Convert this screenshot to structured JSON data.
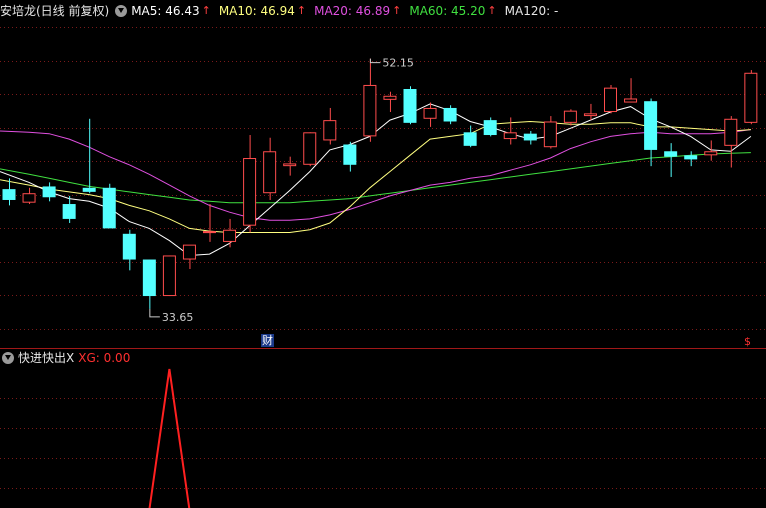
{
  "header": {
    "stock_title": "安培龙(日线 前复权)",
    "ma5_label": "MA5: 46.43",
    "ma10_label": "MA10: 46.94",
    "ma20_label": "MA20: 46.89",
    "ma60_label": "MA60: 45.20",
    "ma120_label": "MA120: -",
    "up_arrow": "↑"
  },
  "indicator_header": {
    "title": "快进快出X",
    "xg_label": "XG: 0.00"
  },
  "badges": {
    "finance": "财",
    "extra": "$"
  },
  "colors": {
    "up": "#ff4d4d",
    "down": "#54ffff",
    "ma5": "#ffffff",
    "ma10": "#ffff80",
    "ma20": "#e050e0",
    "ma60": "#40e040",
    "grid": "#7a1a1a",
    "divider": "#a01818",
    "indicator": "#ff2020"
  },
  "chart_data": {
    "type": "candlestick",
    "price_range": [
      31.5,
      55.0
    ],
    "annotations": {
      "high_label": "52.15",
      "low_label": "33.65"
    },
    "candles": [
      {
        "o": 42.5,
        "h": 43.3,
        "l": 41.3,
        "c": 41.7
      },
      {
        "o": 41.5,
        "h": 42.6,
        "l": 41.4,
        "c": 42.2
      },
      {
        "o": 42.7,
        "h": 43.0,
        "l": 41.6,
        "c": 41.9
      },
      {
        "o": 41.4,
        "h": 42.0,
        "l": 40.0,
        "c": 40.3
      },
      {
        "o": 42.6,
        "h": 47.7,
        "l": 42.2,
        "c": 42.3
      },
      {
        "o": 42.6,
        "h": 42.9,
        "l": 40.2,
        "c": 39.6
      },
      {
        "o": 39.2,
        "h": 39.5,
        "l": 36.5,
        "c": 37.3
      },
      {
        "o": 37.3,
        "h": 37.3,
        "l": 33.65,
        "c": 34.6
      },
      {
        "o": 34.6,
        "h": 37.6,
        "l": 34.6,
        "c": 37.6
      },
      {
        "o": 37.3,
        "h": 38.2,
        "l": 36.6,
        "c": 38.4
      },
      {
        "o": 39.4,
        "h": 41.4,
        "l": 38.6,
        "c": 39.4
      },
      {
        "o": 38.6,
        "h": 40.3,
        "l": 38.2,
        "c": 39.5
      },
      {
        "o": 39.8,
        "h": 46.5,
        "l": 39.3,
        "c": 44.8
      },
      {
        "o": 42.2,
        "h": 46.3,
        "l": 41.7,
        "c": 45.3
      },
      {
        "o": 44.2,
        "h": 44.9,
        "l": 43.5,
        "c": 44.4
      },
      {
        "o": 44.3,
        "h": 46.7,
        "l": 44.2,
        "c": 46.7
      },
      {
        "o": 46.1,
        "h": 48.5,
        "l": 45.8,
        "c": 47.6
      },
      {
        "o": 45.8,
        "h": 46.0,
        "l": 43.8,
        "c": 44.3
      },
      {
        "o": 46.4,
        "h": 52.15,
        "l": 46.0,
        "c": 50.2
      },
      {
        "o": 49.1,
        "h": 49.7,
        "l": 48.2,
        "c": 49.4
      },
      {
        "o": 49.9,
        "h": 50.1,
        "l": 47.3,
        "c": 47.4
      },
      {
        "o": 47.7,
        "h": 48.9,
        "l": 47.1,
        "c": 48.5
      },
      {
        "o": 48.5,
        "h": 48.7,
        "l": 47.3,
        "c": 47.5
      },
      {
        "o": 46.7,
        "h": 47.2,
        "l": 45.6,
        "c": 45.7
      },
      {
        "o": 47.6,
        "h": 47.8,
        "l": 46.4,
        "c": 46.5
      },
      {
        "o": 46.2,
        "h": 47.8,
        "l": 45.8,
        "c": 46.7
      },
      {
        "o": 46.6,
        "h": 46.8,
        "l": 45.8,
        "c": 46.1
      },
      {
        "o": 45.6,
        "h": 47.9,
        "l": 45.5,
        "c": 47.5
      },
      {
        "o": 47.4,
        "h": 48.4,
        "l": 47.2,
        "c": 48.3
      },
      {
        "o": 47.9,
        "h": 48.8,
        "l": 47.6,
        "c": 48.1
      },
      {
        "o": 48.2,
        "h": 50.2,
        "l": 48.1,
        "c": 50.0
      },
      {
        "o": 48.9,
        "h": 50.7,
        "l": 48.9,
        "c": 49.2
      },
      {
        "o": 49.0,
        "h": 49.2,
        "l": 44.2,
        "c": 45.4
      },
      {
        "o": 45.3,
        "h": 45.9,
        "l": 43.4,
        "c": 44.9
      },
      {
        "o": 45.0,
        "h": 45.3,
        "l": 44.2,
        "c": 44.7
      },
      {
        "o": 45.0,
        "h": 46.1,
        "l": 44.6,
        "c": 45.3
      },
      {
        "o": 45.7,
        "h": 47.9,
        "l": 44.1,
        "c": 47.7
      },
      {
        "o": 47.4,
        "h": 51.3,
        "l": 47.3,
        "c": 51.1
      }
    ],
    "ma5": [
      43.8,
      43.0,
      42.3,
      41.8,
      41.6,
      41.1,
      40.1,
      39.6,
      38.7,
      37.6,
      37.7,
      38.5,
      39.8,
      41.1,
      42.4,
      43.8,
      45.4,
      45.8,
      46.4,
      47.6,
      48.1,
      48.8,
      48.3,
      47.5,
      47.1,
      46.6,
      46.2,
      46.4,
      47.0,
      47.6,
      48.2,
      48.6,
      47.7,
      47.1,
      46.4,
      45.4,
      45.3,
      46.4
    ],
    "ma10": [
      43.2,
      42.8,
      42.5,
      42.3,
      42.1,
      41.8,
      41.3,
      40.9,
      40.3,
      39.6,
      39.4,
      39.3,
      39.3,
      39.3,
      39.3,
      39.5,
      40.0,
      41.2,
      42.6,
      43.8,
      45.0,
      46.2,
      46.4,
      46.6,
      47.3,
      47.4,
      47.5,
      47.4,
      47.3,
      47.3,
      47.4,
      47.4,
      47.1,
      47.1,
      47.0,
      46.9,
      46.8,
      46.9
    ],
    "ma20": [
      46.8,
      46.7,
      46.6,
      46.2,
      45.6,
      44.9,
      44.3,
      43.6,
      42.8,
      42.0,
      41.3,
      40.8,
      40.4,
      40.2,
      40.2,
      40.3,
      40.6,
      41.0,
      41.5,
      42.0,
      42.4,
      42.8,
      43.0,
      43.3,
      43.5,
      43.9,
      44.3,
      44.8,
      45.5,
      46.0,
      46.4,
      46.6,
      46.7,
      46.6,
      46.6,
      46.6,
      46.7,
      46.9
    ],
    "ma60": [
      44.0,
      43.6,
      43.3,
      43.0,
      42.7,
      42.5,
      42.3,
      42.1,
      41.9,
      41.7,
      41.6,
      41.5,
      41.5,
      41.5,
      41.5,
      41.6,
      41.7,
      41.8,
      42.0,
      42.2,
      42.4,
      42.6,
      42.8,
      43.0,
      43.2,
      43.4,
      43.6,
      43.8,
      44.0,
      44.2,
      44.4,
      44.6,
      44.8,
      44.9,
      45.0,
      45.1,
      45.15,
      45.2
    ],
    "indicator": [
      0,
      0,
      0,
      0,
      0,
      0,
      0,
      0,
      1,
      0,
      0,
      0,
      0,
      0,
      0,
      0,
      0,
      0,
      0,
      0,
      0,
      0,
      0,
      0,
      0,
      0,
      0,
      0,
      0,
      0,
      0,
      0,
      0,
      0,
      0,
      0,
      0,
      0
    ]
  }
}
